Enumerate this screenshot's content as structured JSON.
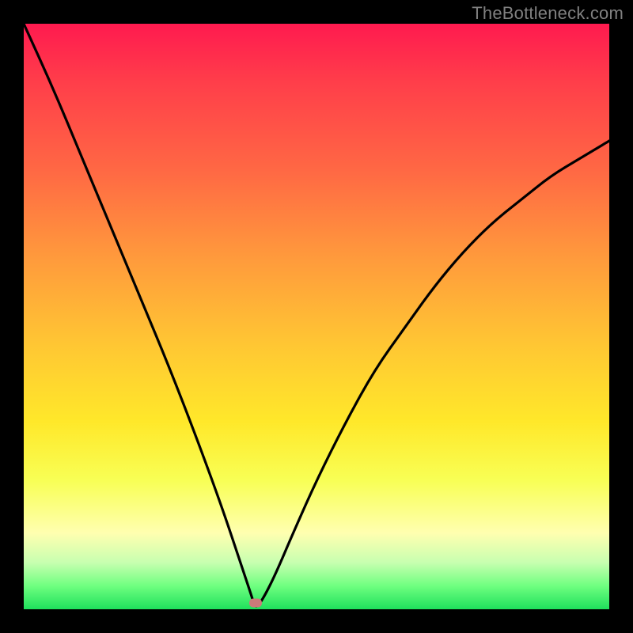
{
  "watermark": "TheBottleneck.com",
  "marker": {
    "x_frac": 0.396,
    "y_pct": 0
  },
  "chart_data": {
    "type": "line",
    "title": "",
    "xlabel": "",
    "ylabel": "",
    "xlim": [
      0,
      1
    ],
    "ylim": [
      0,
      100
    ],
    "series": [
      {
        "name": "bottleneck-curve",
        "x": [
          0.0,
          0.05,
          0.1,
          0.15,
          0.2,
          0.25,
          0.3,
          0.34,
          0.37,
          0.39,
          0.396,
          0.41,
          0.43,
          0.46,
          0.5,
          0.55,
          0.6,
          0.65,
          0.7,
          0.75,
          0.8,
          0.85,
          0.9,
          0.95,
          1.0
        ],
        "y": [
          100,
          89,
          77,
          65,
          53,
          41,
          28,
          17,
          8,
          2,
          0,
          2,
          6,
          13,
          22,
          32,
          41,
          48,
          55,
          61,
          66,
          70,
          74,
          77,
          80
        ]
      }
    ],
    "annotations": [
      {
        "name": "optimal-point",
        "x": 0.396,
        "y": 0
      }
    ],
    "background_gradient": {
      "stops": [
        {
          "pct": 0,
          "color": "#ff1a4f"
        },
        {
          "pct": 25,
          "color": "#ff6844"
        },
        {
          "pct": 55,
          "color": "#ffc733"
        },
        {
          "pct": 78,
          "color": "#f8ff55"
        },
        {
          "pct": 92,
          "color": "#c8ffb0"
        },
        {
          "pct": 100,
          "color": "#1fe05c"
        }
      ]
    }
  }
}
